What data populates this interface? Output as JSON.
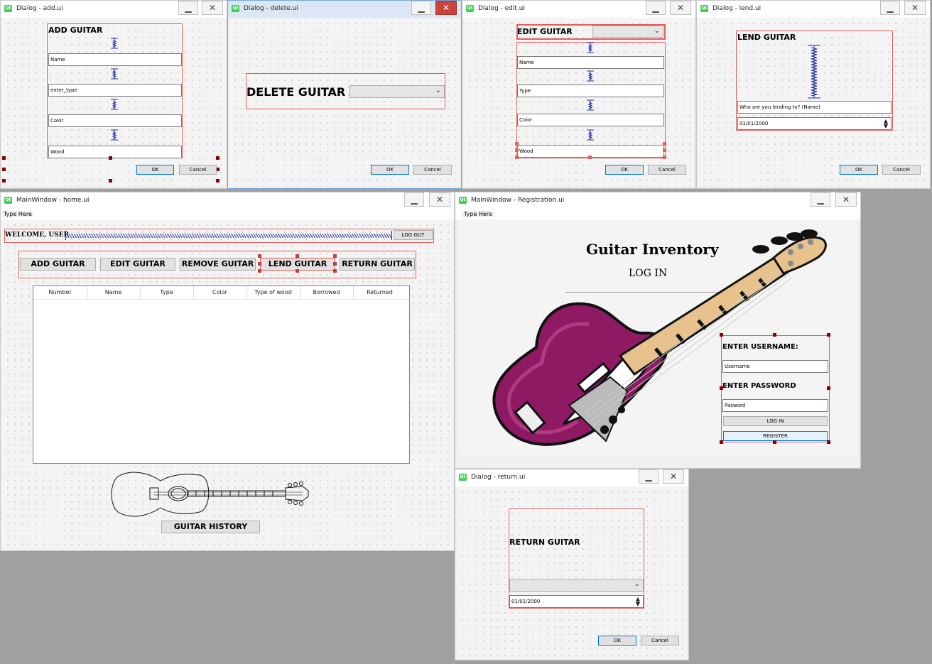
{
  "add": {
    "win_title": "Dialog - add.ui",
    "title": "ADD GUITAR",
    "fields": [
      "Name",
      "enter_type",
      "Color",
      "Wood"
    ],
    "ok": "OK",
    "cancel": "Cancel"
  },
  "del": {
    "win_title": "Dialog - delete.ui",
    "title": "DELETE GUITAR",
    "ok": "OK",
    "cancel": "Cancel"
  },
  "edit": {
    "win_title": "Dialog - edit.ui",
    "title": "EDIT GUITAR",
    "fields": [
      "Name",
      "Type",
      "Color",
      "Wood"
    ],
    "ok": "OK",
    "cancel": "Cancel"
  },
  "lend": {
    "win_title": "Dialog - lend.ui",
    "title": "LEND GUITAR",
    "placeholder": "Who are you lending to? (Name)",
    "date": "01/01/2000",
    "ok": "OK",
    "cancel": "Cancel"
  },
  "home": {
    "win_title": "MainWindow - home.ui",
    "menu": "Type Here",
    "welcome": "WELCOME, USER",
    "logout": "LOG OUT",
    "buttons": [
      "ADD GUITAR",
      "EDIT GUITAR",
      "REMOVE GUITAR",
      "LEND GUITAR",
      "RETURN GUITAR"
    ],
    "columns": [
      "Number",
      "Name",
      "Type",
      "Color",
      "Type of wood",
      "Borrowed",
      "Returned"
    ],
    "history": "GUITAR HISTORY"
  },
  "reg": {
    "win_title": "MainWindow - Registration.ui",
    "menu": "Type Here",
    "heading": "Guitar Inventory",
    "subheading": "LOG IN",
    "user_label": "ENTER USERNAME:",
    "user_placeholder": "Username",
    "pass_label": "ENTER PASSWORD",
    "pass_placeholder": "Pasword",
    "login": "LOG IN",
    "register": "REGISTER"
  },
  "ret": {
    "win_title": "Dialog - return.ui",
    "title": "RETURN GUITAR",
    "date": "01/01/2000",
    "ok": "OK",
    "cancel": "Cancel"
  },
  "colors": {
    "layout_border": "#e06060",
    "guitar_body": "#8e1a63",
    "guitar_neck": "#e8c28c",
    "ok_border": "#0078d7"
  }
}
